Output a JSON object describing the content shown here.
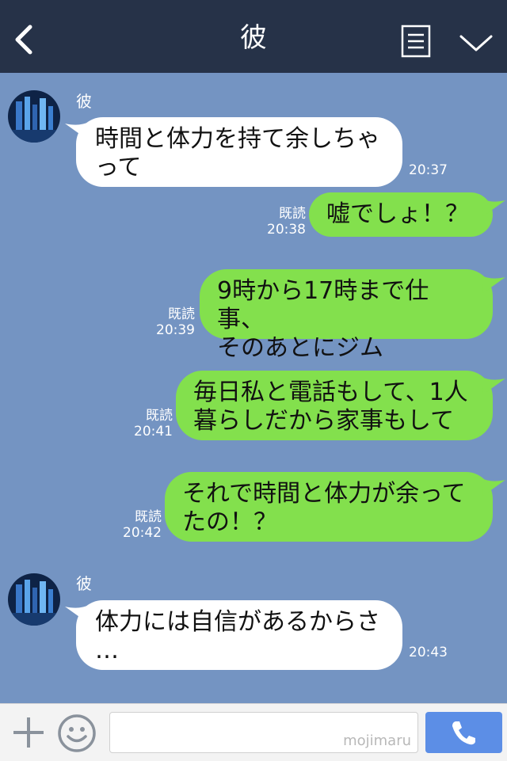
{
  "header": {
    "title": "彼",
    "back_icon": "chevron-left-icon",
    "menu_icon": "notes-menu-icon",
    "dropdown_icon": "chevron-down-icon",
    "bg_color": "#263248"
  },
  "chat": {
    "bg_color": "#7494c2",
    "incoming_bubble_color": "#ffffff",
    "outgoing_bubble_color": "#83e04d",
    "messages": [
      {
        "direction": "in",
        "sender": "彼",
        "text": "時間と体力を持て余しちゃ\nって",
        "time": "20:37"
      },
      {
        "direction": "out",
        "read": "既読",
        "text": "嘘でしょ！？",
        "time": "20:38"
      },
      {
        "direction": "out",
        "read": "既読",
        "text": "9時から17時まで仕事、\nそのあとにジム",
        "time": "20:39"
      },
      {
        "direction": "out",
        "read": "既読",
        "text": "毎日私と電話もして、1人\n暮らしだから家事もして",
        "time": "20:41"
      },
      {
        "direction": "out",
        "read": "既読",
        "text": "それで時間と体力が余って\nたの！？",
        "time": "20:42"
      },
      {
        "direction": "in",
        "sender": "彼",
        "text": "体力には自信があるからさ\n…",
        "time": "20:43"
      }
    ]
  },
  "input_bar": {
    "plus_icon": "plus-icon",
    "emoji_icon": "smiley-icon",
    "watermark": "mojimaru",
    "call_icon": "phone-icon",
    "call_button_color": "#5c8ee6"
  }
}
